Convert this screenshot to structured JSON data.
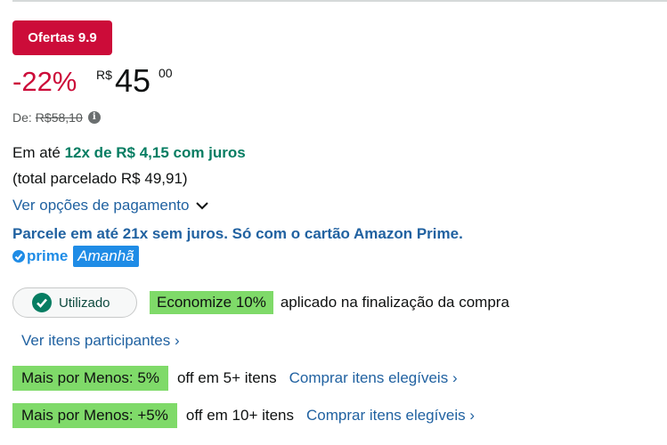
{
  "deal_badge": "Ofertas 9.9",
  "price": {
    "discount": "-22%",
    "currency_symbol": "R$",
    "whole": "45",
    "fraction": "00"
  },
  "list_price": {
    "label": "De:",
    "value": "R$58,10"
  },
  "installments": {
    "prefix": "Em até",
    "highlight": "12x de R$ 4,15 com juros",
    "total": "(total parcelado R$ 49,91)"
  },
  "payment_options_link": "Ver opções de pagamento",
  "prime_card_offer": "Parcele em até 21x sem juros. Só com o cartão Amazon Prime.",
  "prime": {
    "label": "prime",
    "delivery": "Amanhã"
  },
  "coupon": {
    "status": "Utilizado",
    "savings": "Economize 10%",
    "description": "aplicado na finalização da compra",
    "participants_link": "Ver itens participantes"
  },
  "tiers": [
    {
      "badge": "Mais por Menos: 5%",
      "condition": "off em 5+ itens",
      "link": "Comprar itens elegíveis"
    },
    {
      "badge": "Mais por Menos: +5%",
      "condition": "off em 10+ itens",
      "link": "Comprar itens elegíveis"
    }
  ],
  "colors": {
    "deal_red": "#cc0c39",
    "link_blue": "#2162a1",
    "installment_green": "#067d62",
    "highlight_green": "#7fda69",
    "prime_blue": "#1f8ce6"
  }
}
